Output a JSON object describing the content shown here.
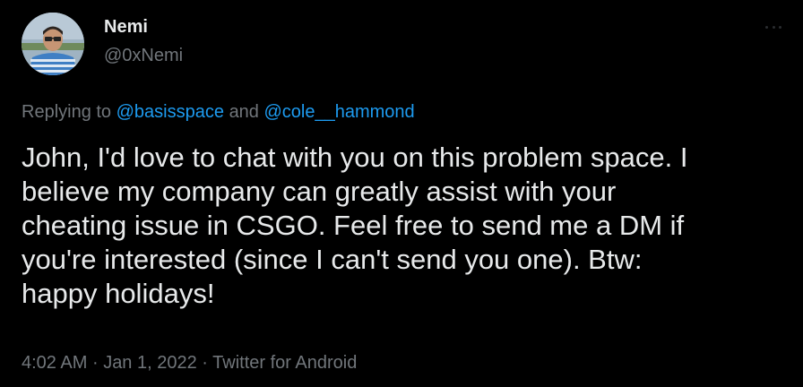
{
  "author": {
    "name": "Nemi",
    "handle": "@0xNemi"
  },
  "reply": {
    "prefix": "Replying to",
    "mention1": "@basisspace",
    "conjunction": "and",
    "mention2": "@cole__hammond"
  },
  "tweet": {
    "line1": "John, I'd love to chat with you on this problem space. I",
    "line2": "believe my company can greatly assist with your",
    "line3": "cheating issue in CSGO. Feel free to send me a DM if",
    "line4": "you're interested (since I can't send you one). Btw:",
    "line5": "happy holidays!"
  },
  "meta": {
    "time": "4:02 AM",
    "date": "Jan 1, 2022",
    "source": "Twitter for Android",
    "separator": "·"
  },
  "icons": {
    "more": "more-options-icon",
    "avatar": "avatar"
  },
  "colors": {
    "background": "#000000",
    "text": "#e7e9ea",
    "secondary": "#71767b",
    "link": "#1d9bf0"
  }
}
